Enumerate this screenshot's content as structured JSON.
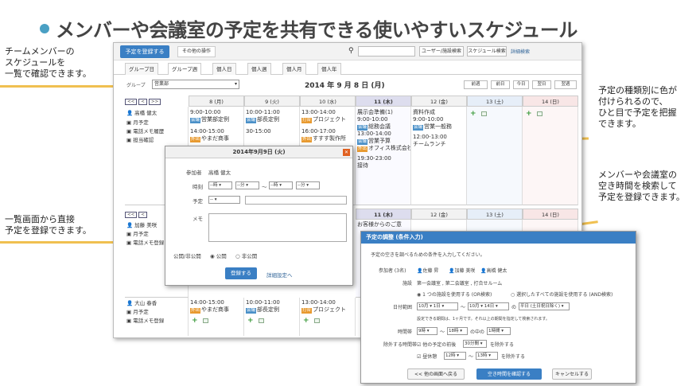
{
  "headline": "メンバーや会議室の予定を共有できる使いやすいスケジュール",
  "callouts": {
    "c1": [
      "チームメンバーの",
      "スケジュールを",
      "一覧で確認できます。"
    ],
    "c2": [
      "予定の種類別に色が",
      "付けられるので、",
      "ひと目で予定を把握",
      "できます。"
    ],
    "c3": [
      "メンバーや会議室の",
      "空き時間を検索して",
      "予定を登録できます。"
    ],
    "c4": [
      "一覧画面から直接",
      "予定を登録できます。"
    ]
  },
  "toolbar": {
    "new_label": "予定を登録する",
    "other_label": "その他の操作",
    "search_icon": "search-icon",
    "user_search": "ユーザー/施設検索",
    "schedule_search": "スケジュール検索",
    "detail_search": "詳細検索"
  },
  "tabs": [
    "グループ日",
    "グループ週",
    "個人日",
    "個人週",
    "個人月",
    "個人年"
  ],
  "nav": {
    "group_label": "グループ",
    "group_value": "営業部",
    "date_title": "2014 年 9 月 8 日 (月)",
    "prev_week": "前週",
    "prev_day": "前日",
    "today": "今日",
    "next_day": "翌日",
    "next_week": "翌週"
  },
  "days": [
    "8 (月)",
    "9 (火)",
    "10 (水)",
    "11 (木)",
    "12 (金)",
    "13 (土)",
    "14 (日)"
  ],
  "members": [
    {
      "name": "高橋 健太",
      "links": [
        "月予定",
        "電話メモ履歴",
        "担当確認"
      ]
    },
    {
      "name": "加藤 美咲",
      "links": [
        "月予定",
        "電話メモ登録"
      ]
    },
    {
      "name": "大山 春香",
      "links": [
        "月予定",
        "電話メモ登録"
      ]
    }
  ],
  "events": {
    "r1c1": [
      {
        "time": "9:00-10:00",
        "tag": "会議",
        "title": "営業部定例"
      },
      {
        "time": "14:00-15:00",
        "tag": "外出",
        "title": "やまだ商事"
      }
    ],
    "r1c2": [
      {
        "time": "10:00-11:00",
        "tag": "会議",
        "title": "部長定例"
      },
      {
        "time": "",
        "tag": "",
        "title": "30-15:00"
      }
    ],
    "r1c3": [
      {
        "time": "13:00-14:00",
        "tag": "打合",
        "title": "プロジェクト"
      },
      {
        "time": "",
        "tag": "",
        "title": "16:00-17:00"
      },
      {
        "time": "",
        "tag": "外出",
        "title": "すすす製作所"
      }
    ],
    "r1c4": [
      {
        "time": "",
        "tag": "",
        "title": "展示会準備(1)"
      },
      {
        "time": "9:00-10:00",
        "tag": "会議",
        "title": "総務会議"
      },
      {
        "time": "13:00-14:00",
        "tag": "会議",
        "title": "営業予算"
      },
      {
        "time": "",
        "tag": "外出",
        "title": "オフィス株式会社"
      },
      {
        "time": "19:30-23:00",
        "tag": "",
        "title": "接待"
      }
    ],
    "r1c5": [
      {
        "time": "",
        "tag": "",
        "title": "資料作成"
      },
      {
        "time": "9:00-10:00",
        "tag": "会議",
        "title": "営業一般務"
      },
      {
        "time": "12:00-13:00",
        "tag": "",
        "title": "チームランチ"
      }
    ],
    "r2c4": [
      {
        "time": "",
        "tag": "",
        "title": "お客様からのご意"
      }
    ],
    "r3c1": [
      {
        "time": "14:00-15:00",
        "tag": "外出",
        "title": "やまだ商事"
      }
    ],
    "r3c2": [
      {
        "time": "10:00-11:00",
        "tag": "会議",
        "title": "部長定例"
      }
    ],
    "r3c3": [
      {
        "time": "13:00-14:00",
        "tag": "打合",
        "title": "プロジェクト"
      }
    ]
  },
  "dialog": {
    "title": "2014年9月9日 (火)",
    "participant_label": "参加者",
    "participant_value": "高橋 健太",
    "time_label": "時刻",
    "hour_ph": "--時",
    "min_ph": "--分",
    "tilde": "〜",
    "subject_label": "予定",
    "subject_select": "--",
    "memo_label": "メモ",
    "visibility_label": "公開/非公開",
    "public": "公開",
    "private": "非公開",
    "register": "登録する",
    "detail_link": "詳細設定へ"
  },
  "adjust": {
    "title": "予定の調整 (条件入力)",
    "intro": "予定の空きを調べるための条件を入力してください。",
    "participants_label": "参加者 (3名)",
    "participants": [
      "佐藤 昇",
      "加藤 美咲",
      "高橋 健太"
    ],
    "facility_label": "施設",
    "facility_value": "第一会議室 , 第二会議室 , 打合せルーム",
    "facility_opt1": "1 つの施設を使用する (OR検索)",
    "facility_opt2": "選択したすべての施設を使用する (AND検索)",
    "range_label": "日付範囲",
    "range_from": "10月 ▾ 1日 ▾",
    "range_to": "10月 ▾ 14日 ▾",
    "range_of": "の",
    "range_weekday": "平日 (土日祝日除く) ▾",
    "range_note": "設定できる期間は、1ヶ月です。それ以上の期間を指定して検索されます。",
    "time_label": "時間帯",
    "time_from": "9時 ▾",
    "time_to": "18時 ▾",
    "time_within": "の中の",
    "time_len": "1時間 ▾",
    "exclude_label": "除外する時間帯",
    "exclude1_pre": "他の予定の前後",
    "exclude1_val": "30分間 ▾",
    "exclude1_post": "を除外する",
    "exclude2_pre": "昼休憩",
    "exclude2_from": "12時 ▾",
    "exclude2_to": "13時 ▾",
    "exclude2_post": "を除外する",
    "back": "<< 他の画面へ戻る",
    "confirm": "空き時間を確認する",
    "cancel": "キャンセルする"
  }
}
